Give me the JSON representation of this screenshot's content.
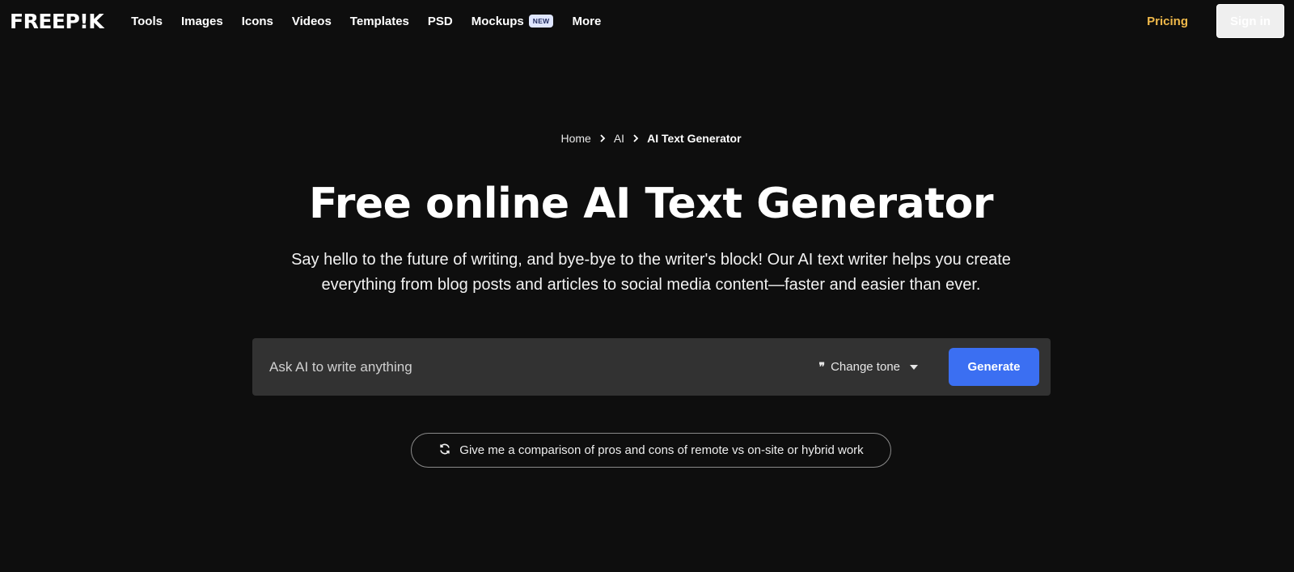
{
  "header": {
    "logo": "FREEP!K",
    "nav": [
      {
        "label": "Tools"
      },
      {
        "label": "Images"
      },
      {
        "label": "Icons"
      },
      {
        "label": "Videos"
      },
      {
        "label": "Templates"
      },
      {
        "label": "PSD"
      },
      {
        "label": "Mockups",
        "badge": "NEW"
      },
      {
        "label": "More"
      }
    ],
    "pricing": "Pricing",
    "signin": "Sign in"
  },
  "breadcrumb": [
    "Home",
    "AI",
    "AI Text Generator"
  ],
  "hero": {
    "title": "Free online AI Text Generator",
    "subtitle": "Say hello to the future of writing, and bye-bye to the writer's block! Our AI text writer helps you create everything from blog posts and articles to social media content—faster and easier than ever."
  },
  "prompt": {
    "placeholder": "Ask AI to write anything",
    "value": "",
    "tone_label": "Change tone",
    "generate_label": "Generate"
  },
  "suggestion": {
    "text": "Give me a comparison of pros and cons of remote vs on-site or hybrid work",
    "icon": "refresh-icon"
  },
  "colors": {
    "background": "#0e0e0e",
    "pricing": "#f0b94a",
    "accent": "#3b6ff2",
    "input_bg": "#323232"
  }
}
